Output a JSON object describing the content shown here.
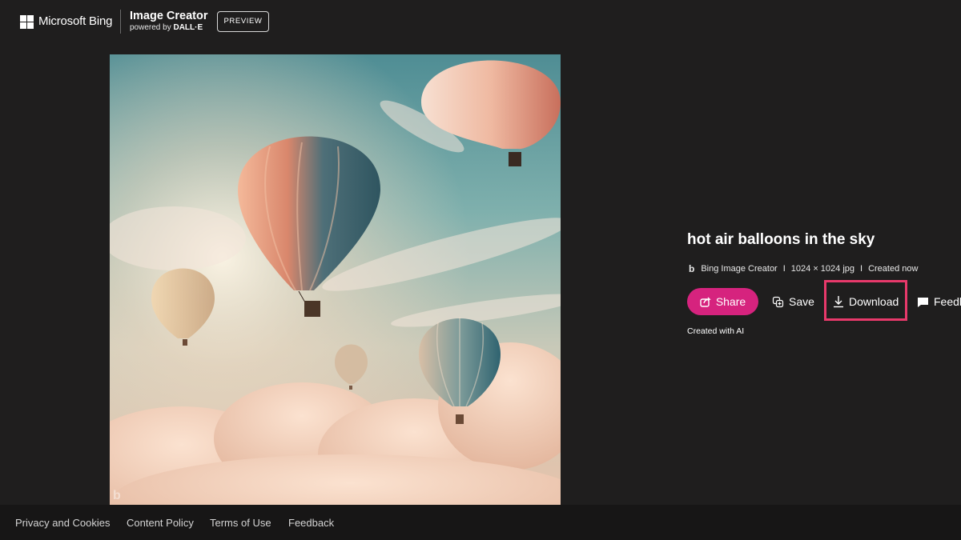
{
  "header": {
    "brand": "Microsoft Bing",
    "product_title": "Image Creator",
    "product_sub_prefix": "powered by ",
    "product_sub_engine": "DALL·E",
    "badge": "PREVIEW"
  },
  "image": {
    "alt": "hot air balloons in the sky",
    "watermark_icon": "bing-logo-icon"
  },
  "details": {
    "title": "hot air balloons in the sky",
    "source": "Bing Image Creator",
    "dimensions": "1024 × 1024 jpg",
    "created": "Created now",
    "separator": "I",
    "share_label": "Share",
    "save_label": "Save",
    "download_label": "Download",
    "feedback_label": "Feedb",
    "created_with_ai": "Created with AI"
  },
  "footer": {
    "links": [
      "Privacy and Cookies",
      "Content Policy",
      "Terms of Use",
      "Feedback"
    ]
  },
  "colors": {
    "background": "#1f1e1e",
    "share_button": "#d6237e",
    "highlight": "#e8396b"
  }
}
